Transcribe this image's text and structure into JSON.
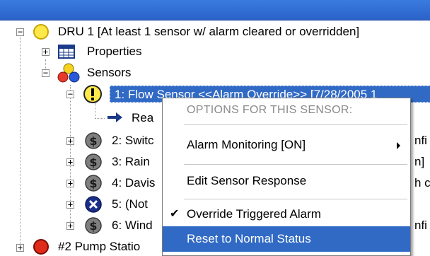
{
  "tree": {
    "root": {
      "label": "DRU 1  [At least 1 sensor w/ alarm cleared or overridden]",
      "icon": "yellow-circle-icon",
      "children": {
        "properties": {
          "label": "Properties",
          "icon": "table-icon"
        },
        "sensors": {
          "label": "Sensors",
          "icon": "sensors-cluster-icon",
          "items": [
            {
              "label": "1: Flow Sensor  <<Alarm Override>> [7/28/2005 1",
              "icon": "warning-icon",
              "selected": true
            },
            {
              "label": "Rea",
              "icon": "arrow-right-icon"
            },
            {
              "label": "2: Switc",
              "tail": "nfi",
              "icon": "sensor-gray-icon"
            },
            {
              "label": "3: Rain",
              "tail": "n]",
              "icon": "sensor-gray-icon"
            },
            {
              "label": "4: Davis",
              "tail": "h c",
              "icon": "sensor-gray-icon"
            },
            {
              "label": "5: (Not",
              "icon": "error-x-icon"
            },
            {
              "label": "6: Wind",
              "tail": "nfi",
              "icon": "sensor-gray-icon"
            }
          ]
        }
      }
    },
    "next_root": {
      "label": "#2 Pump Statio",
      "icon": "red-circle-icon"
    }
  },
  "context_menu": {
    "header": "OPTIONS FOR THIS SENSOR:",
    "items": [
      {
        "label": "Alarm Monitoring [ON]",
        "has_submenu": true,
        "checked": false
      },
      {
        "label": "Edit Sensor Response",
        "has_submenu": false,
        "checked": false
      },
      {
        "label": "Override Triggered Alarm",
        "has_submenu": false,
        "checked": true
      },
      {
        "label": "Reset to Normal Status",
        "has_submenu": false,
        "checked": false,
        "highlighted": true
      }
    ],
    "check_glyph": "✔"
  },
  "colors": {
    "selection": "#316ac5",
    "titlebar": "#2f6fd6"
  }
}
